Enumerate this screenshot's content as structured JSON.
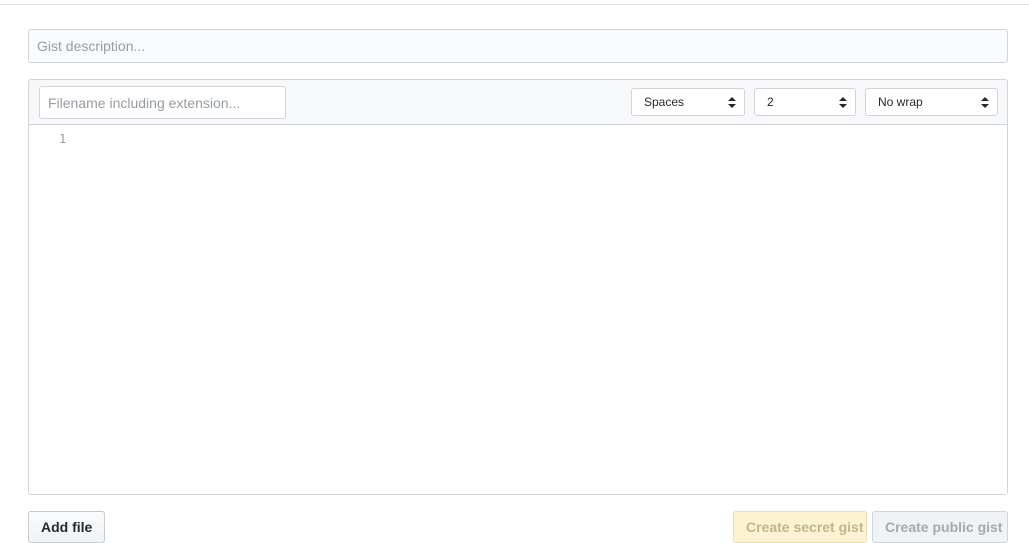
{
  "form": {
    "description_placeholder": "Gist description...",
    "description_value": ""
  },
  "file": {
    "filename_placeholder": "Filename including extension...",
    "filename_value": "",
    "indent_mode": "Spaces",
    "indent_size": "2",
    "wrap_mode": "No wrap",
    "line_numbers": [
      "1"
    ]
  },
  "actions": {
    "add_file": "Add file",
    "create_secret": "Create secret gist",
    "create_public": "Create public gist"
  },
  "icons": {
    "select_arrows": "select-arrows-icon"
  },
  "colors": {
    "secret_button_bg": "#fbf3d2",
    "public_button_bg": "#eff3f6",
    "border": "#d1d5da"
  }
}
